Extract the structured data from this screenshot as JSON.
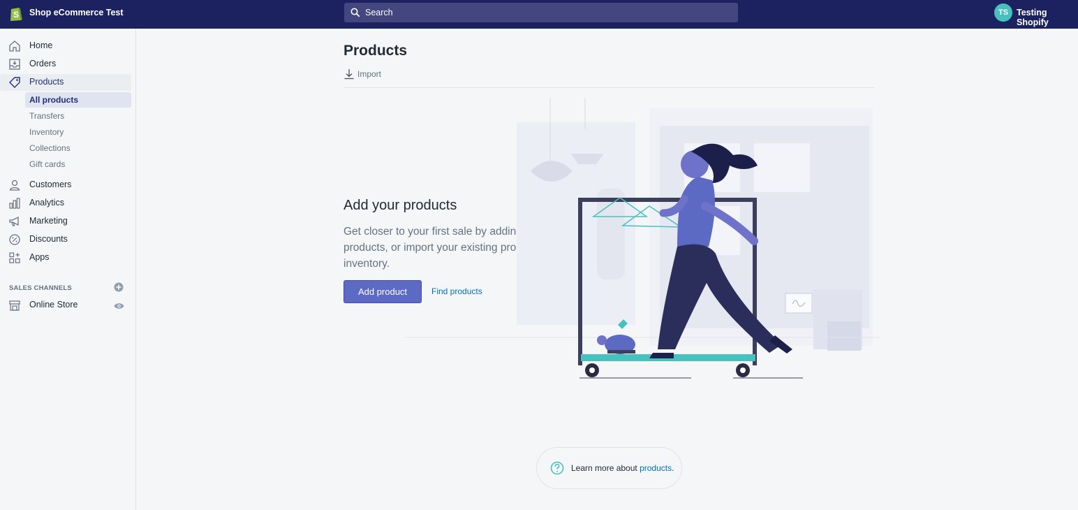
{
  "topbar": {
    "shop_name": "Shop eCommerce Test",
    "search_placeholder": "Search",
    "avatar_initials": "TS",
    "user_name": "Testing Shopify"
  },
  "sidebar": {
    "items": [
      {
        "label": "Home",
        "icon": "home-icon"
      },
      {
        "label": "Orders",
        "icon": "orders-icon"
      },
      {
        "label": "Products",
        "icon": "tag-icon"
      },
      {
        "label": "Customers",
        "icon": "person-icon"
      },
      {
        "label": "Analytics",
        "icon": "bar-chart-icon"
      },
      {
        "label": "Marketing",
        "icon": "megaphone-icon"
      },
      {
        "label": "Discounts",
        "icon": "discount-icon"
      },
      {
        "label": "Apps",
        "icon": "apps-icon"
      }
    ],
    "products_sub": [
      "All products",
      "Transfers",
      "Inventory",
      "Collections",
      "Gift cards"
    ],
    "sales_channels_heading": "SALES CHANNELS",
    "online_store": "Online Store"
  },
  "main": {
    "title": "Products",
    "import_label": "Import",
    "empty_title": "Add your products",
    "empty_description": "Get closer to your first sale by adding products, or import your existing product inventory.",
    "add_product_label": "Add product",
    "find_products_label": "Find products",
    "learn_more_prefix": "Learn more about ",
    "learn_more_link": "products",
    "learn_more_suffix": "."
  },
  "colors": {
    "topbar": "#1c2260",
    "primary_button": "#5c6ac4",
    "link": "#006fbb",
    "avatar": "#47c1bf"
  }
}
